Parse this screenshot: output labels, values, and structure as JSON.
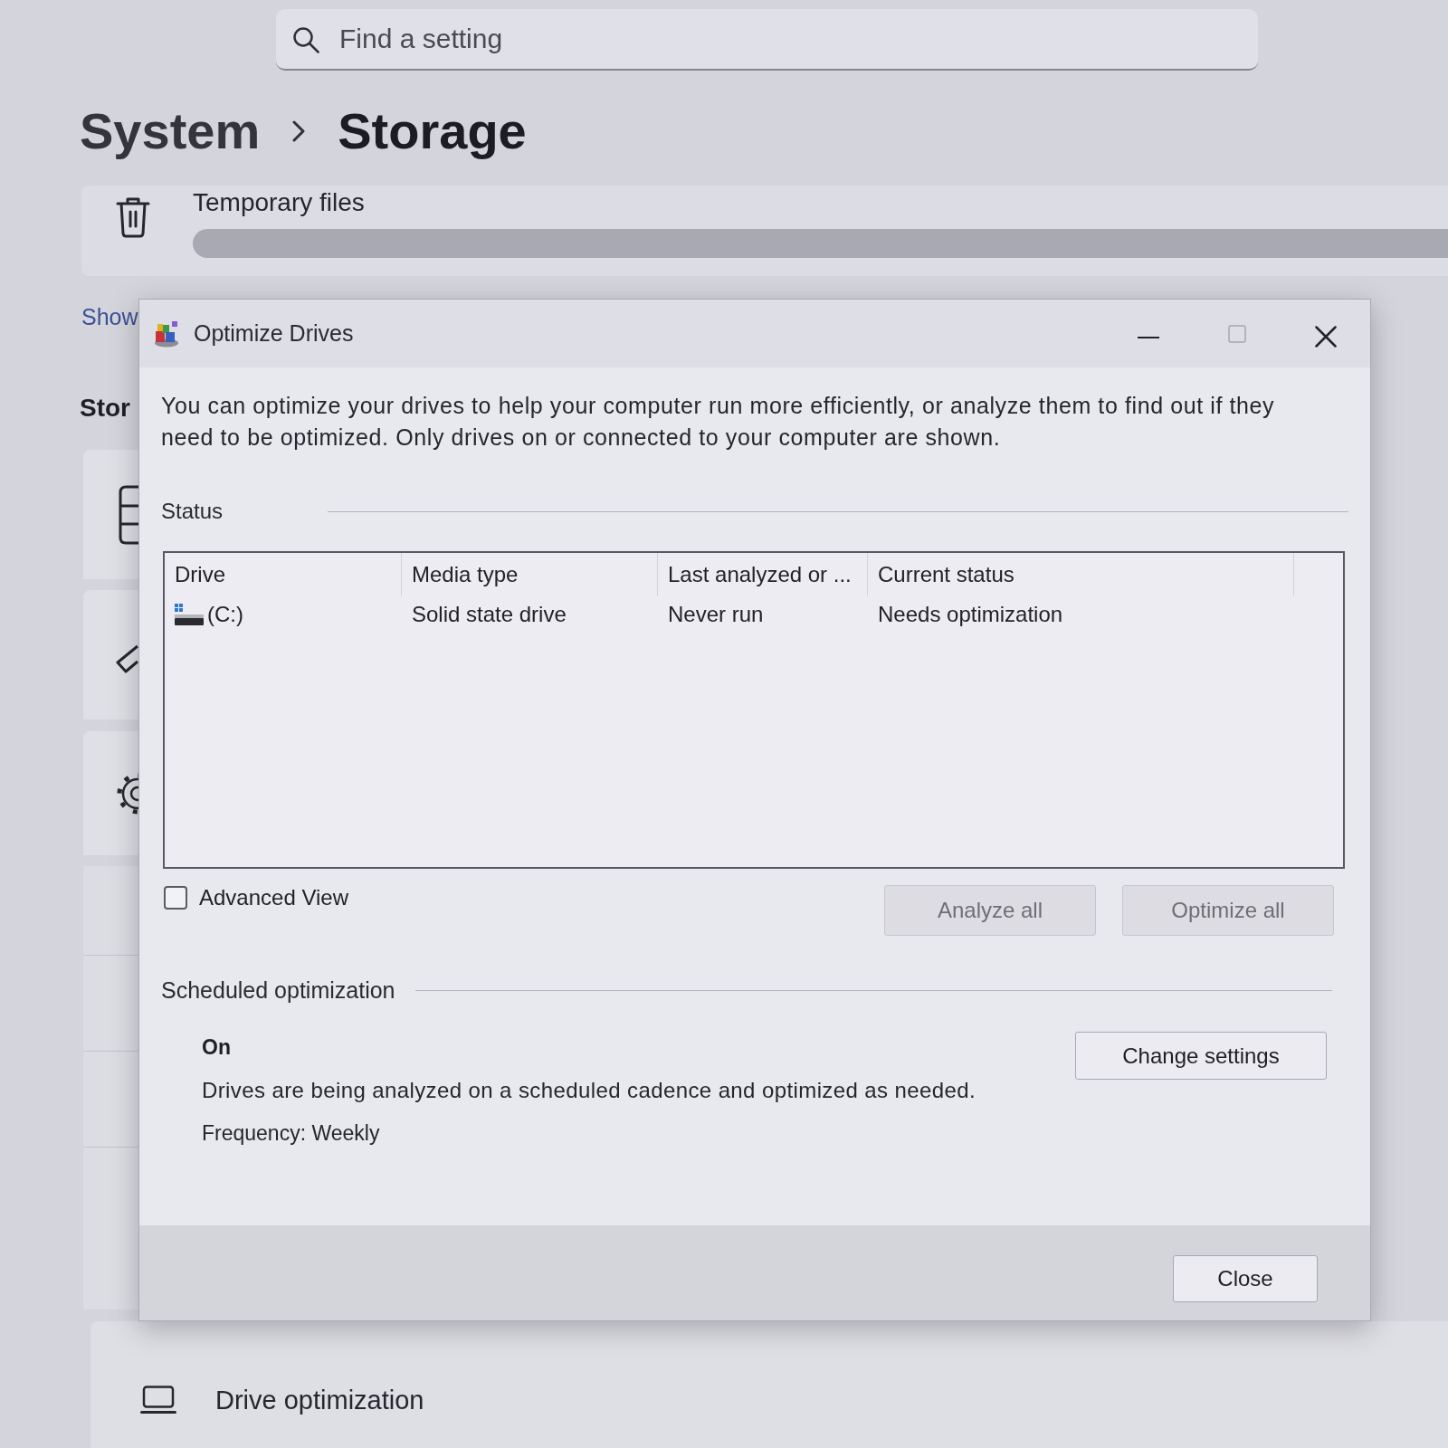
{
  "search": {
    "placeholder": "Find a setting"
  },
  "breadcrumb": [
    "System",
    "Storage"
  ],
  "temporary_files": {
    "label": "Temporary files"
  },
  "show_link": "Show",
  "section_heading": "Stor",
  "bottom_item": {
    "label": "Drive optimization"
  },
  "dialog": {
    "title": "Optimize Drives",
    "window_controls": [
      {
        "kind": "minimize",
        "disabled": false
      },
      {
        "kind": "maximize",
        "disabled": true
      },
      {
        "kind": "close",
        "disabled": false
      }
    ],
    "description": "You can optimize your drives to help your computer run more efficiently, or analyze them to find out if they need to be optimized. Only drives on or connected to your computer are shown.",
    "status": {
      "heading": "Status",
      "table": {
        "columns": [
          "Drive",
          "Media type",
          "Last analyzed or ...",
          "Current status"
        ],
        "rows": [
          {
            "cells": [
              "(C:)",
              "Solid state drive",
              "Never run",
              "Needs optimization"
            ]
          }
        ]
      }
    },
    "advanced_view": {
      "label": "Advanced View",
      "checked": false
    },
    "buttons": [
      {
        "label": "Analyze all",
        "disabled": true
      },
      {
        "label": "Optimize all",
        "disabled": true
      }
    ],
    "scheduled": {
      "heading": "Scheduled optimization",
      "state": "On",
      "description": "Drives are being analyzed on a scheduled cadence and optimized as needed.",
      "frequency": "Frequency: Weekly",
      "button": {
        "label": "Change settings"
      }
    },
    "close_button": {
      "label": "Close"
    }
  }
}
